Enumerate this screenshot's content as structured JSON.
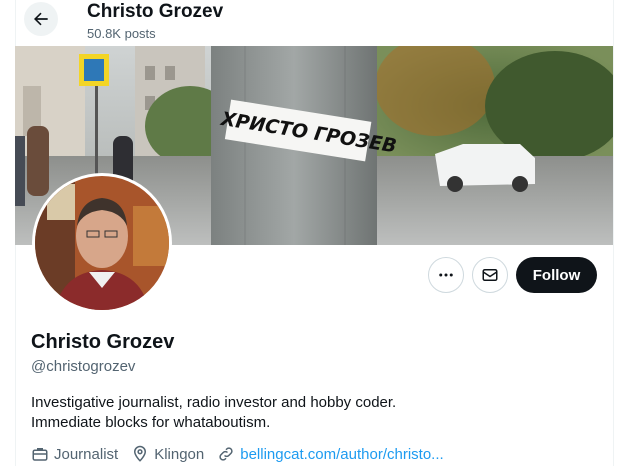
{
  "header": {
    "name": "Christo Grozev",
    "posts": "50.8K posts",
    "back_icon": "arrow-left-icon"
  },
  "banner": {
    "sticker_text": "ХРИСТО ГРОЗЕВ"
  },
  "actions": {
    "more_icon": "more-horizontal-icon",
    "message_icon": "envelope-icon",
    "follow_label": "Follow"
  },
  "profile": {
    "display_name": "Christo Grozev",
    "handle": "@christogrozev",
    "bio_line1": "Investigative journalist, radio investor and hobby coder.",
    "bio_line2": "Immediate blocks for whataboutism.",
    "profession": "Journalist",
    "location": "Klingon",
    "website": "bellingcat.com/author/christo..."
  },
  "colors": {
    "accent": "#1d9bf0",
    "primary_text": "#0f1419",
    "secondary_text": "#536471",
    "follow_bg": "#0f1419"
  }
}
